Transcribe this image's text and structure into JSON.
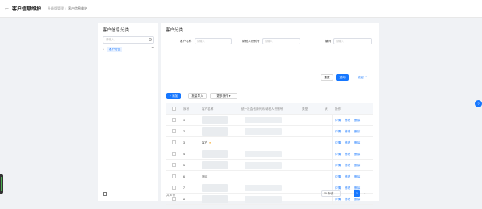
{
  "header": {
    "back_icon": "←",
    "title": "客户信息维护",
    "breadcrumb": [
      "升级版管理",
      "客户信息维护"
    ]
  },
  "left_panel": {
    "title": "客户信息分类",
    "search_placeholder": "请输入",
    "tree_item": "客户分类",
    "tree_caret": "▸",
    "add_icon": "+"
  },
  "main": {
    "title": "客户分类",
    "filters": [
      {
        "label": "客户名称",
        "placeholder": "请输入"
      },
      {
        "label": "纳税人识别号",
        "placeholder": "请输入"
      },
      {
        "label": "编码",
        "placeholder": "请输入"
      }
    ],
    "reset_label": "重置",
    "query_label": "查询",
    "collapse_label": "收起 ⌃",
    "add_label": "+ 添加",
    "import_label": "批量导入",
    "export_label": "更多操作 ▾",
    "columns": [
      "序号",
      "客户名称",
      "统一社会信用代码/纳税人识别号",
      "类型",
      "状",
      "操作"
    ],
    "rows": [
      {
        "index": "1",
        "name": ""
      },
      {
        "index": "2",
        "name": ""
      },
      {
        "index": "3",
        "name": "客户"
      },
      {
        "index": "4",
        "name": ""
      },
      {
        "index": "5",
        "name": ""
      },
      {
        "index": "6",
        "name": "测试"
      },
      {
        "index": "7",
        "name": ""
      },
      {
        "index": "8",
        "name": ""
      }
    ],
    "row_ops": [
      "详情",
      "修改",
      "删除"
    ],
    "total": "共 8 条",
    "page_size": "10 条/页",
    "current_page": "1"
  },
  "accent": "#1677ff"
}
